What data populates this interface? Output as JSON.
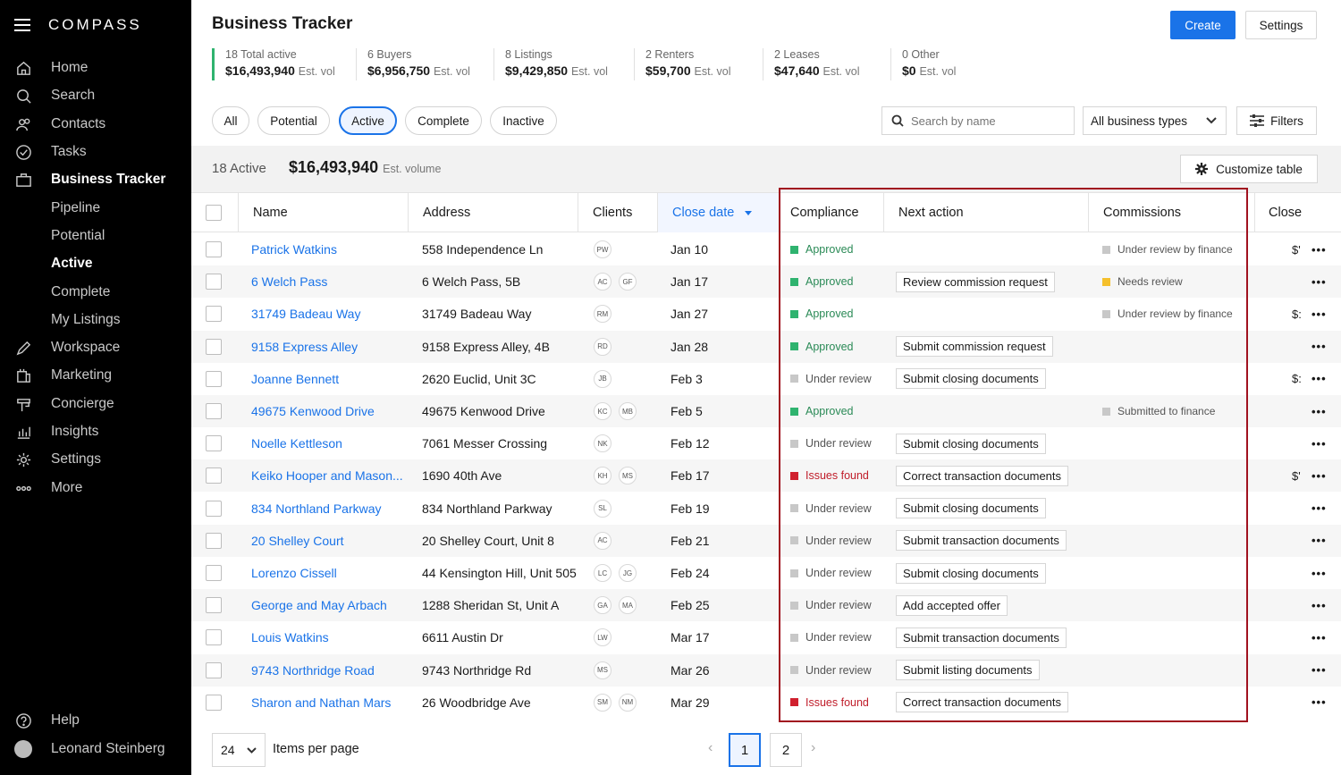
{
  "app": {
    "logo": "COMPASS",
    "title": "Business Tracker"
  },
  "sidebar": {
    "items": [
      {
        "label": "Home",
        "icon": "home-icon"
      },
      {
        "label": "Search",
        "icon": "search-icon"
      },
      {
        "label": "Contacts",
        "icon": "contacts-icon"
      },
      {
        "label": "Tasks",
        "icon": "tasks-icon"
      },
      {
        "label": "Business Tracker",
        "icon": "briefcase-icon"
      },
      {
        "label": "Pipeline"
      },
      {
        "label": "Potential"
      },
      {
        "label": "Active"
      },
      {
        "label": "Complete"
      },
      {
        "label": "My Listings"
      },
      {
        "label": "Workspace",
        "icon": "pencil-icon"
      },
      {
        "label": "Marketing",
        "icon": "marketing-icon"
      },
      {
        "label": "Concierge",
        "icon": "concierge-icon"
      },
      {
        "label": "Insights",
        "icon": "insights-icon"
      },
      {
        "label": "Settings",
        "icon": "gear-icon"
      },
      {
        "label": "More",
        "icon": "more-icon"
      }
    ],
    "help": "Help",
    "user": "Leonard Steinberg"
  },
  "header": {
    "create": "Create",
    "settings": "Settings"
  },
  "stats": [
    {
      "top": "18 Total active",
      "value": "$16,493,940",
      "unit": "Est. vol"
    },
    {
      "top": "6 Buyers",
      "value": "$6,956,750",
      "unit": "Est. vol"
    },
    {
      "top": "8 Listings",
      "value": "$9,429,850",
      "unit": "Est. vol"
    },
    {
      "top": "2 Renters",
      "value": "$59,700",
      "unit": "Est. vol"
    },
    {
      "top": "2 Leases",
      "value": "$47,640",
      "unit": "Est. vol"
    },
    {
      "top": "0 Other",
      "value": "$0",
      "unit": "Est. vol"
    }
  ],
  "filters": {
    "chips": [
      "All",
      "Potential",
      "Active",
      "Complete",
      "Inactive"
    ],
    "active_chip": "Active",
    "search_placeholder": "Search by name",
    "type_select": "All business types",
    "filters_label": "Filters"
  },
  "summary": {
    "count": "18 Active",
    "volume": "$16,493,940",
    "volume_unit": "Est. volume",
    "customize": "Customize table"
  },
  "table": {
    "columns": [
      "Name",
      "Address",
      "Clients",
      "Close date",
      "Compliance",
      "Next action",
      "Commissions",
      "Close"
    ],
    "rows": [
      {
        "name": "Patrick Watkins",
        "address": "558 Independence Ln",
        "clients": [
          "PW"
        ],
        "date": "Jan 10",
        "compliance": "Approved",
        "action": "",
        "commission": "Under review by finance",
        "close": "$'"
      },
      {
        "name": "6 Welch Pass",
        "address": "6 Welch Pass, 5B",
        "clients": [
          "AC",
          "GF"
        ],
        "date": "Jan 17",
        "compliance": "Approved",
        "action": "Review commission request",
        "commission": "Needs review",
        "close": ""
      },
      {
        "name": "31749 Badeau Way",
        "address": "31749 Badeau Way",
        "clients": [
          "RM"
        ],
        "date": "Jan 27",
        "compliance": "Approved",
        "action": "",
        "commission": "Under review by finance",
        "close": "$:"
      },
      {
        "name": "9158 Express Alley",
        "address": "9158 Express Alley, 4B",
        "clients": [
          "RD"
        ],
        "date": "Jan 28",
        "compliance": "Approved",
        "action": "Submit commission request",
        "commission": "",
        "close": ""
      },
      {
        "name": "Joanne Bennett",
        "address": "2620 Euclid, Unit 3C",
        "clients": [
          "JB"
        ],
        "date": "Feb 3",
        "compliance": "Under review",
        "action": "Submit closing documents",
        "commission": "",
        "close": "$:"
      },
      {
        "name": "49675 Kenwood Drive",
        "address": "49675 Kenwood Drive",
        "clients": [
          "KC",
          "MB"
        ],
        "date": "Feb 5",
        "compliance": "Approved",
        "action": "",
        "commission": "Submitted to finance",
        "close": ""
      },
      {
        "name": "Noelle Kettleson",
        "address": "7061 Messer Crossing",
        "clients": [
          "NK"
        ],
        "date": "Feb 12",
        "compliance": "Under review",
        "action": "Submit closing documents",
        "commission": "",
        "close": ""
      },
      {
        "name": "Keiko Hooper and Mason...",
        "address": "1690 40th Ave",
        "clients": [
          "KH",
          "MS"
        ],
        "date": "Feb 17",
        "compliance": "Issues found",
        "action": "Correct transaction documents",
        "commission": "",
        "close": "$'"
      },
      {
        "name": "834 Northland Parkway",
        "address": "834 Northland Parkway",
        "clients": [
          "SL"
        ],
        "date": "Feb 19",
        "compliance": "Under review",
        "action": "Submit closing documents",
        "commission": "",
        "close": ""
      },
      {
        "name": "20 Shelley Court",
        "address": "20 Shelley Court, Unit 8",
        "clients": [
          "AC"
        ],
        "date": "Feb 21",
        "compliance": "Under review",
        "action": "Submit transaction documents",
        "commission": "",
        "close": ""
      },
      {
        "name": "Lorenzo Cissell",
        "address": "44 Kensington Hill, Unit 505",
        "clients": [
          "LC",
          "JG"
        ],
        "date": "Feb 24",
        "compliance": "Under review",
        "action": "Submit closing documents",
        "commission": "",
        "close": ""
      },
      {
        "name": "George and May Arbach",
        "address": "1288 Sheridan St, Unit A",
        "clients": [
          "GA",
          "MA"
        ],
        "date": "Feb 25",
        "compliance": "Under review",
        "action": "Add accepted offer",
        "commission": "",
        "close": ""
      },
      {
        "name": "Louis Watkins",
        "address": "6611 Austin Dr",
        "clients": [
          "LW"
        ],
        "date": "Mar 17",
        "compliance": "Under review",
        "action": "Submit transaction documents",
        "commission": "",
        "close": ""
      },
      {
        "name": "9743 Northridge Road",
        "address": "9743 Northridge Rd",
        "clients": [
          "MS"
        ],
        "date": "Mar 26",
        "compliance": "Under review",
        "action": "Submit listing documents",
        "commission": "",
        "close": ""
      },
      {
        "name": "Sharon and Nathan Mars",
        "address": "26 Woodbridge Ave",
        "clients": [
          "SM",
          "NM"
        ],
        "date": "Mar 29",
        "compliance": "Issues found",
        "action": "Correct transaction documents",
        "commission": "",
        "close": ""
      }
    ]
  },
  "colors": {
    "approved": "#2fb36f",
    "under_review": "#c8c8c8",
    "issues": "#d0202e",
    "needs_review": "#f5c02c",
    "accent": "#1a73e8",
    "highlight": "#a1121f"
  },
  "pagination": {
    "per_page": "24",
    "per_page_label": "Items per page",
    "pages": [
      "1",
      "2"
    ],
    "current": "1"
  }
}
